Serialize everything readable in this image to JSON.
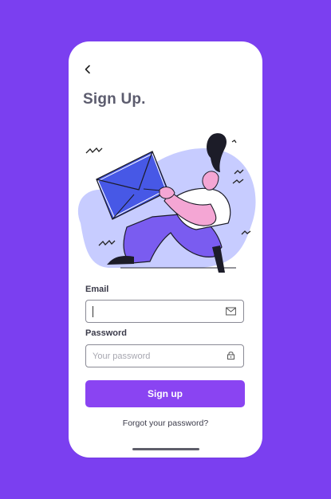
{
  "screen": {
    "title": "Sign Up.",
    "back_icon": "chevron-left-icon"
  },
  "illustration": {
    "description_icon": "person-carrying-envelope-illustration"
  },
  "form": {
    "email": {
      "label": "Email",
      "value": "",
      "placeholder": "",
      "icon": "envelope-icon"
    },
    "password": {
      "label": "Password",
      "value": "",
      "placeholder": "Your password",
      "icon": "lock-icon"
    },
    "submit_label": "Sign up",
    "forgot_label": "Forgot your password?"
  },
  "colors": {
    "background": "#7b3ff0",
    "button": "#8a44f2",
    "envelope": "#4758e6",
    "figure_pants": "#7a5cf0",
    "blob": "#c7ccff"
  }
}
